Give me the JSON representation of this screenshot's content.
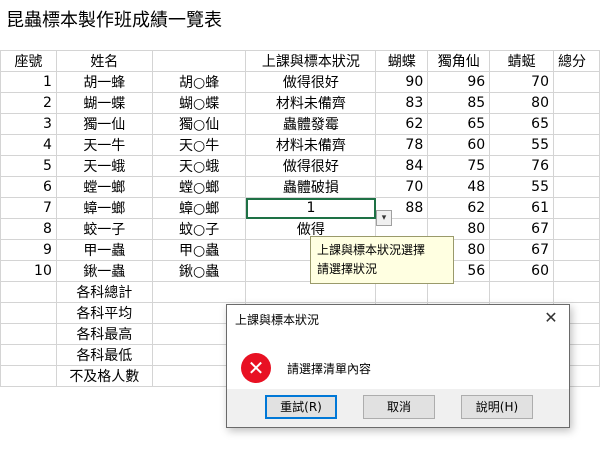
{
  "sheet": {
    "title": "昆蟲標本製作班成績一覽表",
    "headers": [
      "座號",
      "姓名",
      "",
      "上課與標本狀況",
      "蝴蝶",
      "獨角仙",
      "蜻蜓",
      "總分"
    ],
    "rows": [
      {
        "no": "1",
        "name": "胡一蜂",
        "masked": "胡○蜂",
        "status": "做得很好",
        "butterfly": "90",
        "beetle": "96",
        "dragonfly": "70"
      },
      {
        "no": "2",
        "name": "蝴一蝶",
        "masked": "蝴○蝶",
        "status": "材料未備齊",
        "butterfly": "83",
        "beetle": "85",
        "dragonfly": "80"
      },
      {
        "no": "3",
        "name": "獨一仙",
        "masked": "獨○仙",
        "status": "蟲體發霉",
        "butterfly": "62",
        "beetle": "65",
        "dragonfly": "65"
      },
      {
        "no": "4",
        "name": "天一牛",
        "masked": "天○牛",
        "status": "材料未備齊",
        "butterfly": "78",
        "beetle": "60",
        "dragonfly": "55"
      },
      {
        "no": "5",
        "name": "天一蛾",
        "masked": "天○蛾",
        "status": "做得很好",
        "butterfly": "84",
        "beetle": "75",
        "dragonfly": "76"
      },
      {
        "no": "6",
        "name": "螳一螂",
        "masked": "螳○螂",
        "status": "蟲體破損",
        "butterfly": "70",
        "beetle": "48",
        "dragonfly": "55"
      },
      {
        "no": "7",
        "name": "蟑一螂",
        "masked": "蟑○螂",
        "status": "1",
        "butterfly": "88",
        "beetle": "62",
        "dragonfly": "61"
      },
      {
        "no": "8",
        "name": "蛟一子",
        "masked": "蚊○子",
        "status": "做得",
        "butterfly": "",
        "beetle": "80",
        "dragonfly": "67"
      },
      {
        "no": "9",
        "name": "甲一蟲",
        "masked": "甲○蟲",
        "status": "",
        "butterfly": "",
        "beetle": "80",
        "dragonfly": "67"
      },
      {
        "no": "10",
        "name": "鍬一蟲",
        "masked": "鍬○蟲",
        "status": "",
        "butterfly": "",
        "beetle": "56",
        "dragonfly": "60"
      }
    ],
    "summary": [
      "各科總計",
      "各科平均",
      "各科最高",
      "各科最低",
      "不及格人數"
    ]
  },
  "validation_tooltip": {
    "title": "上課與標本狀況選擇",
    "message": "請選擇狀況"
  },
  "dialog": {
    "title": "上課與標本狀況",
    "close": "✕",
    "message": "請選擇清單內容",
    "buttons": {
      "retry": "重試(R)",
      "cancel": "取消",
      "help": "說明(H)"
    },
    "icon_color": "#e81123"
  },
  "dropdown_arrow": "▾",
  "colors": {
    "selection": "#1e7145",
    "tooltip_bg": "#ffffe1",
    "gridline": "#d4d4d4"
  }
}
